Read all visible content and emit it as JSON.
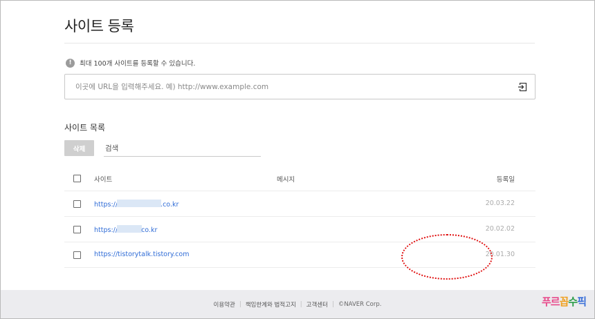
{
  "page": {
    "title": "사이트 등록"
  },
  "notice": {
    "icon": "info-icon",
    "text": "최대 100개 사이트를 등록할 수 있습니다."
  },
  "url_input": {
    "value": "",
    "placeholder": "이곳에 URL을 입력해주세요. 예) http://www.example.com",
    "submit_icon": "enter-icon"
  },
  "site_list": {
    "title": "사이트 목록",
    "delete_label": "삭제",
    "search_placeholder": "검색",
    "columns": {
      "site": "사이트",
      "message": "메시지",
      "date": "등록일"
    },
    "rows": [
      {
        "url_prefix": "https://",
        "url_suffix": ".co.kr",
        "message": "",
        "date": "20.03.22"
      },
      {
        "url_prefix": "https://",
        "url_suffix": "co.kr",
        "message": "",
        "date": "20.02.02"
      },
      {
        "url_prefix": "https://tistorytalk.tistory.com",
        "url_suffix": "",
        "message": "",
        "date": "20.01.30"
      }
    ]
  },
  "footer": {
    "links": [
      "이용약관",
      "책임한계와 법적고지",
      "고객센터"
    ],
    "copyright": "©NAVER Corp.",
    "logo_text": "푸르꼽수픽"
  },
  "colors": {
    "link": "#2e6bd6",
    "annotation": "#e01010",
    "footer_bg": "#ececef"
  }
}
